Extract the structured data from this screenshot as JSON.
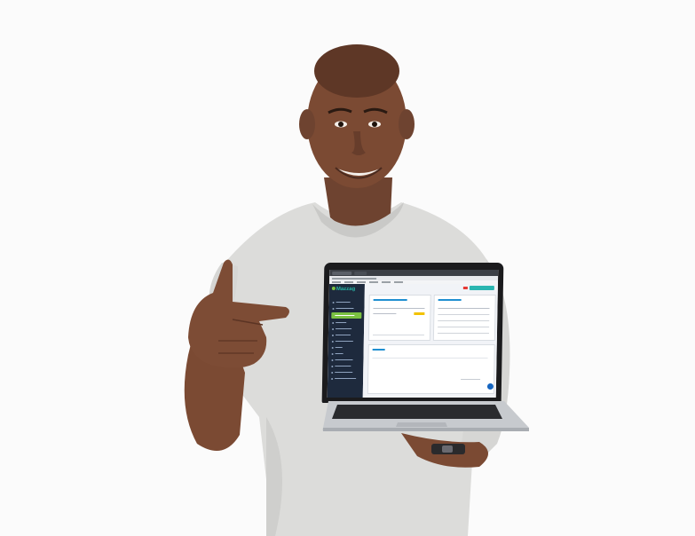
{
  "scene": {
    "description_free": true,
    "colors": {
      "background": "#fbfbfb",
      "skin": "#7a4a33",
      "shirt": "#d9d9d7",
      "laptop_body": "#c9ccd0",
      "accent_green": "#7bc242",
      "accent_teal": "#2ab5b0",
      "sidebar": "#1e2a3d"
    }
  },
  "screen": {
    "logo_text": "Mazzag",
    "logo_icon": "map-pin-icon"
  }
}
